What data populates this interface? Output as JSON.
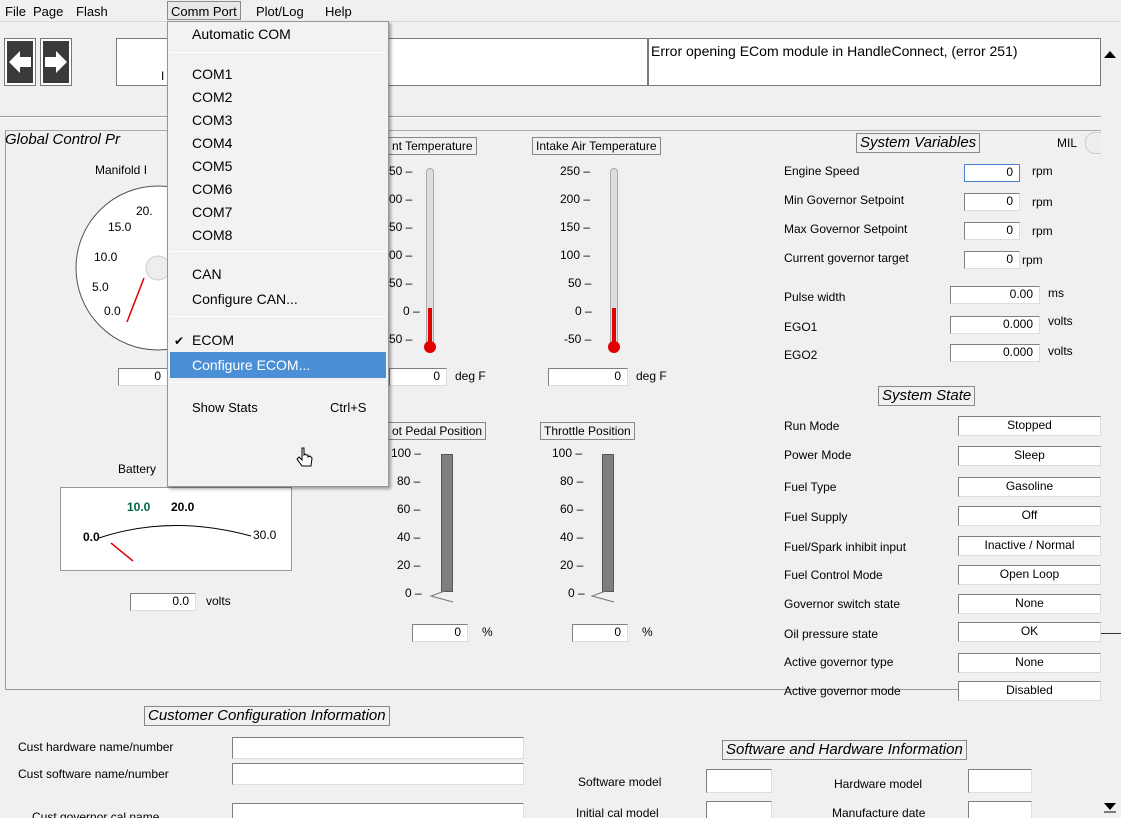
{
  "menubar": {
    "file": "File",
    "page": "Page",
    "flash": "Flash",
    "comm_port": "Comm Port",
    "plot_log": "Plot/Log",
    "help": "Help"
  },
  "status": {
    "message": "Error opening ECom module in HandleConnect, (error 251)",
    "stub1": "I"
  },
  "global_control": {
    "title": "Global Control Pr",
    "manifold_label": "Manifold I",
    "manifold_value": "0",
    "manifold_ticks": [
      "20.",
      "15.0",
      "10.0",
      "5.0",
      "0.0"
    ],
    "battery_label": "Battery",
    "battery_value": "0.0",
    "battery_unit": "volts",
    "battery_ticks": [
      "10.0",
      "20.0",
      "0.0",
      "30.0"
    ]
  },
  "coolant": {
    "label": "nt Temperature",
    "ticks": [
      "50 –",
      "00 –",
      "50 –",
      "00 –",
      "50 –",
      "0 –",
      "50 –"
    ],
    "value": "0",
    "unit": "deg F"
  },
  "intake": {
    "label": "Intake Air Temperature",
    "ticks": [
      "250 –",
      "200 –",
      "150 –",
      "100 –",
      "50 –",
      "0 –",
      "-50 –"
    ],
    "value": "0",
    "unit": "deg F"
  },
  "pedal": {
    "label": "ot Pedal Position",
    "ticks": [
      "100 –",
      "80 –",
      "60 –",
      "40 –",
      "20 –",
      "0 –"
    ],
    "value": "0",
    "unit": "%"
  },
  "throttle": {
    "label": "Throttle Position",
    "ticks": [
      "100 –",
      "80 –",
      "60 –",
      "40 –",
      "20 –",
      "0 –"
    ],
    "value": "0",
    "unit": "%"
  },
  "system_variables": {
    "title": "System Variables",
    "mil": "MIL",
    "rows": [
      {
        "label": "Engine Speed",
        "value": "0",
        "unit": "rpm"
      },
      {
        "label": "Min Governor Setpoint",
        "value": "0",
        "unit": "rpm"
      },
      {
        "label": "Max Governor Setpoint",
        "value": "0",
        "unit": "rpm"
      },
      {
        "label": "Current governor target",
        "value": "0",
        "unit": "rpm"
      },
      {
        "label": "Pulse width",
        "value": "0.00",
        "unit": "ms"
      },
      {
        "label": "EGO1",
        "value": "0.000",
        "unit": "volts"
      },
      {
        "label": "EGO2",
        "value": "0.000",
        "unit": "volts"
      }
    ]
  },
  "system_state": {
    "title": "System State",
    "rows": [
      {
        "label": "Run Mode",
        "value": "Stopped"
      },
      {
        "label": "Power Mode",
        "value": "Sleep"
      },
      {
        "label": "Fuel Type",
        "value": "Gasoline"
      },
      {
        "label": "Fuel Supply",
        "value": "Off"
      },
      {
        "label": "Fuel/Spark inhibit input",
        "value": "Inactive / Normal"
      },
      {
        "label": "Fuel Control Mode",
        "value": "Open Loop"
      },
      {
        "label": "Governor switch state",
        "value": "None"
      },
      {
        "label": "Oil pressure state",
        "value": "OK"
      },
      {
        "label": "Active governor type",
        "value": "None"
      },
      {
        "label": "Active governor mode",
        "value": "Disabled"
      }
    ]
  },
  "customer": {
    "title": "Customer Configuration Information",
    "hw": "Cust hardware name/number",
    "sw": "Cust software name/number",
    "gov": "Cust governor cal name"
  },
  "swhw": {
    "title": "Software and Hardware Information",
    "software_model": "Software model",
    "initial_cal": "Initial cal model",
    "hardware_model": "Hardware model",
    "manufacture_date": "Manufacture date"
  },
  "comm_menu": {
    "automatic": "Automatic COM",
    "com1": "COM1",
    "com2": "COM2",
    "com3": "COM3",
    "com4": "COM4",
    "com5": "COM5",
    "com6": "COM6",
    "com7": "COM7",
    "com8": "COM8",
    "can": "CAN",
    "configure_can": "Configure CAN...",
    "ecom": "ECOM",
    "configure_ecom": "Configure ECOM...",
    "show_stats": "Show Stats",
    "show_stats_shortcut": "Ctrl+S",
    "check": "✔"
  },
  "colors": {
    "highlight": "#4b8fd6",
    "thermo_red": "#e00000",
    "needle": "#e00000"
  }
}
